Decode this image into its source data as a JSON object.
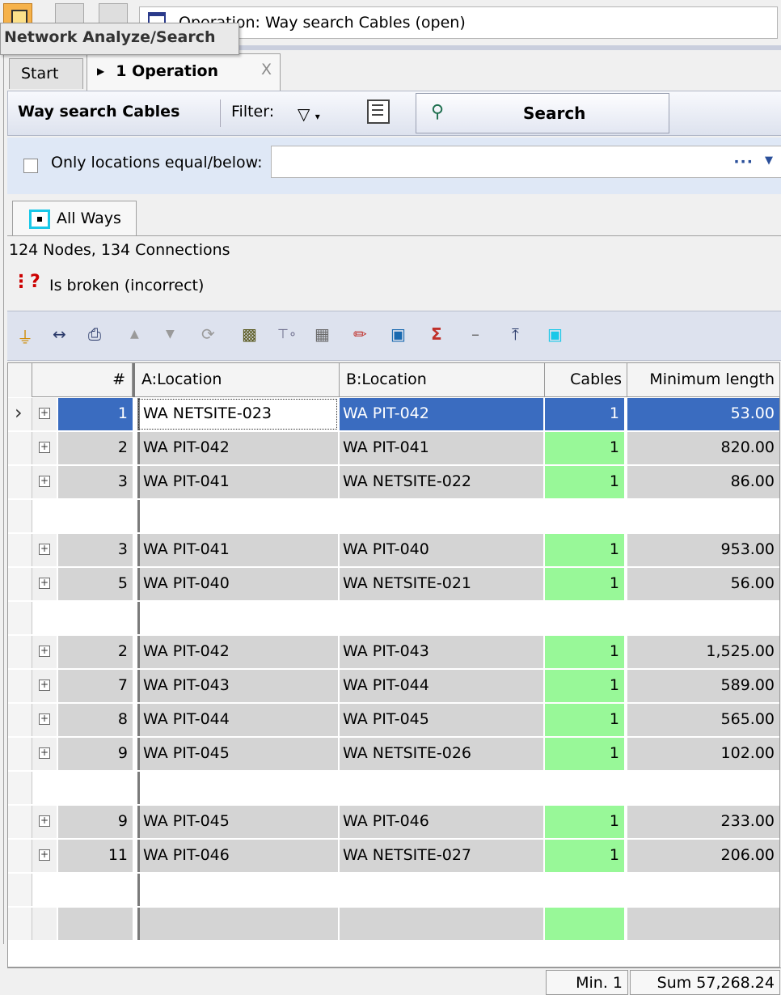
{
  "window": {
    "title": "Operation: Way search Cables  (open)",
    "tooltip": "Network Analyze/Search"
  },
  "tabs": [
    {
      "label": "Start",
      "active": false
    },
    {
      "label": "1 Operation",
      "active": true,
      "close": "X"
    }
  ],
  "search_bar": {
    "title": "Way search Cables",
    "filter_label": "Filter:",
    "search_label": "Search"
  },
  "location_filter": {
    "checkbox_label": "Only locations equal/below:",
    "value": "",
    "browse": "···"
  },
  "ways_tab": {
    "label": "All Ways"
  },
  "info": {
    "summary": "124 Nodes, 134 Connections",
    "status": "Is broken (incorrect)"
  },
  "grid": {
    "columns": [
      "#",
      "A:Location",
      "B:Location",
      "Cables",
      "Minimum length"
    ],
    "rows": [
      {
        "num": "1",
        "a": "WA NETSITE-023",
        "b": "WA PIT-042",
        "cables": "1",
        "length": "53.00",
        "selected": true
      },
      {
        "num": "2",
        "a": "WA PIT-042",
        "b": "WA PIT-041",
        "cables": "1",
        "length": "820.00"
      },
      {
        "num": "3",
        "a": "WA PIT-041",
        "b": "WA NETSITE-022",
        "cables": "1",
        "length": "86.00"
      },
      {
        "blank": true
      },
      {
        "num": "3",
        "a": "WA PIT-041",
        "b": "WA PIT-040",
        "cables": "1",
        "length": "953.00"
      },
      {
        "num": "5",
        "a": "WA PIT-040",
        "b": "WA NETSITE-021",
        "cables": "1",
        "length": "56.00"
      },
      {
        "blank": true
      },
      {
        "num": "2",
        "a": "WA PIT-042",
        "b": "WA PIT-043",
        "cables": "1",
        "length": "1,525.00"
      },
      {
        "num": "7",
        "a": "WA PIT-043",
        "b": "WA PIT-044",
        "cables": "1",
        "length": "589.00"
      },
      {
        "num": "8",
        "a": "WA PIT-044",
        "b": "WA PIT-045",
        "cables": "1",
        "length": "565.00"
      },
      {
        "num": "9",
        "a": "WA PIT-045",
        "b": "WA NETSITE-026",
        "cables": "1",
        "length": "102.00"
      },
      {
        "blank": true
      },
      {
        "num": "9",
        "a": "WA PIT-045",
        "b": "WA PIT-046",
        "cables": "1",
        "length": "233.00"
      },
      {
        "num": "11",
        "a": "WA PIT-046",
        "b": "WA NETSITE-027",
        "cables": "1",
        "length": "206.00"
      },
      {
        "blank": true
      }
    ]
  },
  "footer": {
    "min": "Min. 1",
    "sum": "Sum 57,268.24"
  },
  "colors": {
    "selection": "#3a6cc0",
    "cables_cell": "#98f898",
    "row_bg": "#d4d4d4"
  }
}
